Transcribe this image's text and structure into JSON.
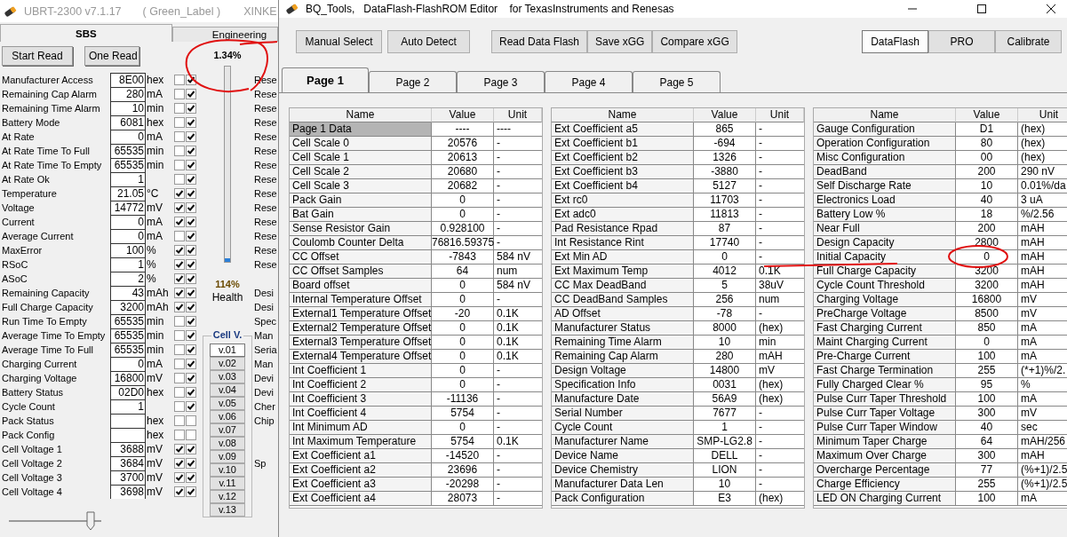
{
  "left_window": {
    "title": "UBRT-2300 v7.1.17",
    "label": "( Green_Label )",
    "vendor": "XINKE",
    "tabs": [
      {
        "label": "SBS",
        "selected": true
      },
      {
        "label": "Engineering",
        "selected": false
      }
    ],
    "buttons": [
      "Start Read",
      "One Read"
    ],
    "progress": {
      "reading": "1.34%",
      "level": 0.0134
    },
    "health": {
      "reading": "114%",
      "label": "Health"
    },
    "rows": [
      {
        "name": "Manufacturer Access",
        "value": "8E00",
        "unit": "hex",
        "check_1": false,
        "check_2": true,
        "side_text": "Rese"
      },
      {
        "name": "Remaining Cap Alarm",
        "value": "280",
        "unit": "mA",
        "check_1": false,
        "check_2": true,
        "side_text": "Rese"
      },
      {
        "name": "Remaining Time Alarm",
        "value": "10",
        "unit": "min",
        "check_1": false,
        "check_2": true,
        "side_text": "Rese"
      },
      {
        "name": "Battery Mode",
        "value": "6081",
        "unit": "hex",
        "check_1": false,
        "check_2": true,
        "side_text": "Rese"
      },
      {
        "name": "At Rate",
        "value": "0",
        "unit": "mA",
        "check_1": false,
        "check_2": true,
        "side_text": "Rese"
      },
      {
        "name": "At Rate Time To Full",
        "value": "65535",
        "unit": "min",
        "check_1": false,
        "check_2": true,
        "side_text": "Rese"
      },
      {
        "name": "At Rate Time To Empty",
        "value": "65535",
        "unit": "min",
        "check_1": false,
        "check_2": true,
        "side_text": "Rese"
      },
      {
        "name": "At Rate Ok",
        "value": "1",
        "check_1": false,
        "check_2": true,
        "side_text": "Rese"
      },
      {
        "name": "Temperature",
        "value": "21.05",
        "unit": "°C",
        "check_1": true,
        "check_2": true,
        "side_text": "Rese"
      },
      {
        "name": "Voltage",
        "value": "14772",
        "unit": "mV",
        "check_1": true,
        "check_2": true,
        "side_text": "Rese"
      },
      {
        "name": "Current",
        "value": "0",
        "unit": "mA",
        "check_1": true,
        "check_2": true,
        "side_text": "Rese"
      },
      {
        "name": "Average Current",
        "value": "0",
        "unit": "mA",
        "check_1": false,
        "check_2": true,
        "side_text": "Rese"
      },
      {
        "name": "MaxError",
        "value": "100",
        "unit": "%",
        "check_1": true,
        "check_2": true,
        "side_text": "Rese"
      },
      {
        "name": "RSoC",
        "value": "1",
        "unit": "%",
        "check_1": true,
        "check_2": true,
        "side_text": "Rese"
      },
      {
        "name": "ASoC",
        "value": "2",
        "unit": "%",
        "check_1": true,
        "check_2": true
      },
      {
        "name": "Remaining Capacity",
        "value": "43",
        "unit": "mAh",
        "check_1": true,
        "check_2": true,
        "side_text": "Desi"
      },
      {
        "name": "Full Charge Capacity",
        "value": "3200",
        "unit": "mAh",
        "check_1": true,
        "check_2": true,
        "side_text": "Desi"
      },
      {
        "name": "Run Time To Empty",
        "value": "65535",
        "unit": "min",
        "check_1": false,
        "check_2": true,
        "side_text": "Spec"
      },
      {
        "name": "Average Time To Empty",
        "value": "65535",
        "unit": "min",
        "check_1": false,
        "check_2": true,
        "side_text": "Man"
      },
      {
        "name": "Average Time To Full",
        "value": "65535",
        "unit": "min",
        "check_1": false,
        "check_2": true,
        "side_text": "Seria"
      },
      {
        "name": "Charging Current",
        "value": "0",
        "unit": "mA",
        "check_1": false,
        "check_2": true,
        "side_text": "Man"
      },
      {
        "name": "Charging Voltage",
        "value": "16800",
        "unit": "mV",
        "check_1": false,
        "check_2": true,
        "side_text": "Devi"
      },
      {
        "name": "Battery Status",
        "value": "02D0",
        "unit": "hex",
        "check_1": false,
        "check_2": true,
        "side_text": "Devi"
      },
      {
        "name": "Cycle Count",
        "value": "1",
        "check_1": false,
        "check_2": true,
        "side_text": "Cher"
      },
      {
        "name": "Pack Status",
        "unit": "hex",
        "check_1": false,
        "check_2": false,
        "side_text": "Chip"
      },
      {
        "name": "Pack Config",
        "unit": "hex",
        "check_1": false,
        "check_2": false
      },
      {
        "name": "Cell Voltage 1",
        "value": "3688",
        "unit": "mV",
        "check_1": true,
        "check_2": true
      },
      {
        "name": "Cell Voltage 2",
        "value": "3684",
        "unit": "mV",
        "check_1": true,
        "check_2": true,
        "side_text": "Sp"
      },
      {
        "name": "Cell Voltage 3",
        "value": "3700",
        "unit": "mV",
        "check_1": true,
        "check_2": true
      },
      {
        "name": "Cell Voltage 4",
        "value": "3698",
        "unit": "mV",
        "check_1": true,
        "check_2": true
      }
    ],
    "cell_voltage_group": {
      "title": "Cell V.",
      "buttons": [
        {
          "label": "v.01",
          "selected": true
        },
        {
          "label": "v.02",
          "selected": false
        },
        {
          "label": "v.03",
          "selected": false
        },
        {
          "label": "v.04",
          "selected": false
        },
        {
          "label": "v.05",
          "selected": false
        },
        {
          "label": "v.06",
          "selected": false
        },
        {
          "label": "v.07",
          "selected": false
        },
        {
          "label": "v.08",
          "selected": false
        },
        {
          "label": "v.09",
          "selected": false
        },
        {
          "label": "v.10",
          "selected": false
        },
        {
          "label": "v.11",
          "selected": false
        },
        {
          "label": "v.12",
          "selected": false
        },
        {
          "label": "v.13",
          "selected": false
        }
      ]
    },
    "slider": {
      "level": 0.88
    }
  },
  "right_window": {
    "title": "BQ_Tools,   DataFlash-FlashROM Editor    for TexasInstruments and Renesas",
    "toolbar_groups": [
      [
        "Manual Select",
        "Auto Detect"
      ],
      [
        "Read Data Flash",
        "Save xGG",
        "Compare xGG"
      ]
    ],
    "modes": [
      {
        "label": "DataFlash",
        "selected": true
      },
      {
        "label": "PRO",
        "selected": false
      },
      {
        "label": "Calibrate",
        "selected": false
      }
    ],
    "tabs": [
      {
        "label": "Page 1",
        "selected": true
      },
      {
        "label": "Page 2",
        "selected": false
      },
      {
        "label": "Page 3",
        "selected": false
      },
      {
        "label": "Page 4",
        "selected": false
      },
      {
        "label": "Page 5",
        "selected": false
      }
    ],
    "tables": [
      {
        "columns": [
          "Name",
          "Value",
          "Unit"
        ],
        "rows": [
          {
            "name": "Page 1 Data",
            "value": "----",
            "unit": "----",
            "selected": true
          },
          {
            "name": "Cell Scale 0",
            "value": "20576",
            "unit": "-",
            "selected": false
          },
          {
            "name": "Cell Scale 1",
            "value": "20613",
            "unit": "-",
            "selected": false
          },
          {
            "name": "Cell Scale 2",
            "value": "20680",
            "unit": "-",
            "selected": false
          },
          {
            "name": "Cell Scale 3",
            "value": "20682",
            "unit": "-",
            "selected": false
          },
          {
            "name": "Pack Gain",
            "value": "0",
            "unit": "-",
            "selected": false
          },
          {
            "name": "Bat Gain",
            "value": "0",
            "unit": "-",
            "selected": false
          },
          {
            "name": "Sense Resistor Gain",
            "value": "0.928100",
            "unit": "-",
            "selected": false
          },
          {
            "name": "Coulomb Counter Delta",
            "value": "76816.59375",
            "unit": "-",
            "selected": false
          },
          {
            "name": "CC Offset",
            "value": "-7843",
            "unit": "584 nV",
            "selected": false
          },
          {
            "name": "CC Offset Samples",
            "value": "64",
            "unit": "num",
            "selected": false
          },
          {
            "name": "Board offset",
            "value": "0",
            "unit": "584 nV",
            "selected": false
          },
          {
            "name": "Internal Temperature Offset",
            "value": "0",
            "unit": "-",
            "selected": false
          },
          {
            "name": "External1 Temperature Offset",
            "value": "-20",
            "unit": "0.1K",
            "selected": false
          },
          {
            "name": "External2 Temperature Offset",
            "value": "0",
            "unit": "0.1K",
            "selected": false
          },
          {
            "name": "External3 Temperature Offset",
            "value": "0",
            "unit": "0.1K",
            "selected": false
          },
          {
            "name": "External4 Temperature Offset",
            "value": "0",
            "unit": "0.1K",
            "selected": false
          },
          {
            "name": "Int Coefficient 1",
            "value": "0",
            "unit": "-",
            "selected": false
          },
          {
            "name": "Int Coefficient 2",
            "value": "0",
            "unit": "-",
            "selected": false
          },
          {
            "name": "Int Coefficient 3",
            "value": "-11136",
            "unit": "-",
            "selected": false
          },
          {
            "name": "Int Coefficient 4",
            "value": "5754",
            "unit": "-",
            "selected": false
          },
          {
            "name": "Int Minimum AD",
            "value": "0",
            "unit": "-",
            "selected": false
          },
          {
            "name": "Int Maximum Temperature",
            "value": "5754",
            "unit": "0.1K",
            "selected": false
          },
          {
            "name": "Ext Coefficient a1",
            "value": "-14520",
            "unit": "-",
            "selected": false
          },
          {
            "name": "Ext Coefficient a2",
            "value": "23696",
            "unit": "-",
            "selected": false
          },
          {
            "name": "Ext Coefficient a3",
            "value": "-20298",
            "unit": "-",
            "selected": false
          },
          {
            "name": "Ext Coefficient a4",
            "value": "28073",
            "unit": "-",
            "selected": false
          }
        ]
      },
      {
        "columns": [
          "Name",
          "Value",
          "Unit"
        ],
        "rows": [
          {
            "name": "Ext Coefficient a5",
            "value": "865",
            "unit": "-",
            "selected": false
          },
          {
            "name": "Ext Coefficient b1",
            "value": "-694",
            "unit": "-",
            "selected": false
          },
          {
            "name": "Ext Coefficient b2",
            "value": "1326",
            "unit": "-",
            "selected": false
          },
          {
            "name": "Ext Coefficient b3",
            "value": "-3880",
            "unit": "-",
            "selected": false
          },
          {
            "name": "Ext Coefficient b4",
            "value": "5127",
            "unit": "-",
            "selected": false
          },
          {
            "name": "Ext rc0",
            "value": "11703",
            "unit": "-",
            "selected": false
          },
          {
            "name": "Ext adc0",
            "value": "11813",
            "unit": "-",
            "selected": false
          },
          {
            "name": "Pad Resistance Rpad",
            "value": "87",
            "unit": "-",
            "selected": false
          },
          {
            "name": "Int Resistance Rint",
            "value": "17740",
            "unit": "-",
            "selected": false
          },
          {
            "name": "Ext Min AD",
            "value": "0",
            "unit": "-",
            "selected": false
          },
          {
            "name": "Ext Maximum Temp",
            "value": "4012",
            "unit": "0.1K",
            "selected": false
          },
          {
            "name": "CC Max DeadBand",
            "value": "5",
            "unit": "38uV",
            "selected": false
          },
          {
            "name": "CC DeadBand Samples",
            "value": "256",
            "unit": "num",
            "selected": false
          },
          {
            "name": "AD Offset",
            "value": "-78",
            "unit": "-",
            "selected": false
          },
          {
            "name": "Manufacturer Status",
            "value": "8000",
            "unit": "(hex)",
            "selected": false
          },
          {
            "name": "Remaining Time Alarm",
            "value": "10",
            "unit": "min",
            "selected": false
          },
          {
            "name": "Remaining Cap Alarm",
            "value": "280",
            "unit": "mAH",
            "selected": false
          },
          {
            "name": "Design Voltage",
            "value": "14800",
            "unit": "mV",
            "selected": false
          },
          {
            "name": "Specification Info",
            "value": "0031",
            "unit": "(hex)",
            "selected": false
          },
          {
            "name": "Manufacture Date",
            "value": "56A9",
            "unit": "(hex)",
            "selected": false
          },
          {
            "name": "Serial Number",
            "value": "7677",
            "unit": "-",
            "selected": false
          },
          {
            "name": "Cycle Count",
            "value": "1",
            "unit": "-",
            "selected": false
          },
          {
            "name": "Manufacturer Name",
            "value": "SMP-LG2.8",
            "unit": "-",
            "selected": false
          },
          {
            "name": "Device Name",
            "value": "DELL",
            "unit": "-",
            "selected": false
          },
          {
            "name": "Device Chemistry",
            "value": "LION",
            "unit": "-",
            "selected": false
          },
          {
            "name": "Manufacturer Data Len",
            "value": "10",
            "unit": "-",
            "selected": false
          },
          {
            "name": "Pack Configuration",
            "value": "E3",
            "unit": "(hex)",
            "selected": false
          }
        ]
      },
      {
        "columns": [
          "Name",
          "Value",
          "Unit"
        ],
        "rows": [
          {
            "name": "Gauge Configuration",
            "value": "D1",
            "unit": "(hex)",
            "selected": false
          },
          {
            "name": "Operation Configuration",
            "value": "80",
            "unit": "(hex)",
            "selected": false
          },
          {
            "name": "Misc Configuration",
            "value": "00",
            "unit": "(hex)",
            "selected": false
          },
          {
            "name": "DeadBand",
            "value": "200",
            "unit": "290 nV",
            "selected": false
          },
          {
            "name": "Self Discharge Rate",
            "value": "10",
            "unit": "0.01%/da",
            "selected": false
          },
          {
            "name": "Electronics Load",
            "value": "40",
            "unit": "3 uA",
            "selected": false
          },
          {
            "name": "Battery Low %",
            "value": "18",
            "unit": "%/2.56",
            "selected": false
          },
          {
            "name": "Near Full",
            "value": "200",
            "unit": "mAH",
            "selected": false
          },
          {
            "name": "Design Capacity",
            "value": "2800",
            "unit": "mAH",
            "selected": false
          },
          {
            "name": "Initial Capacity",
            "value": "0",
            "unit": "mAH",
            "selected": false
          },
          {
            "name": "Full Charge Capacity",
            "value": "3200",
            "unit": "mAH",
            "selected": false
          },
          {
            "name": "Cycle Count Threshold",
            "value": "3200",
            "unit": "mAH",
            "selected": false
          },
          {
            "name": "Charging Voltage",
            "value": "16800",
            "unit": "mV",
            "selected": false
          },
          {
            "name": "PreCharge Voltage",
            "value": "8500",
            "unit": "mV",
            "selected": false
          },
          {
            "name": "Fast Charging Current",
            "value": "850",
            "unit": "mA",
            "selected": false
          },
          {
            "name": "Maint Charging Current",
            "value": "0",
            "unit": "mA",
            "selected": false
          },
          {
            "name": "Pre-Charge Current",
            "value": "100",
            "unit": "mA",
            "selected": false
          },
          {
            "name": "Fast Charge Termination",
            "value": "255",
            "unit": "(*+1)%/2.",
            "selected": false
          },
          {
            "name": "Fully Charged Clear %",
            "value": "95",
            "unit": "%",
            "selected": false
          },
          {
            "name": "Pulse Curr Taper Threshold",
            "value": "100",
            "unit": "mA",
            "selected": false
          },
          {
            "name": "Pulse Curr Taper Voltage",
            "value": "300",
            "unit": "mV",
            "selected": false
          },
          {
            "name": "Pulse Curr Taper Window",
            "value": "40",
            "unit": "sec",
            "selected": false
          },
          {
            "name": "Minimum Taper Charge",
            "value": "64",
            "unit": "mAH/256",
            "selected": false
          },
          {
            "name": "Maximum Over Charge",
            "value": "300",
            "unit": "mAH",
            "selected": false
          },
          {
            "name": "Overcharge Percentage",
            "value": "77",
            "unit": "(%+1)/2.5",
            "selected": false
          },
          {
            "name": "Charge Efficiency",
            "value": "255",
            "unit": "(%+1)/2.5",
            "selected": false
          },
          {
            "name": "LED ON Charging Current",
            "value": "100",
            "unit": "mA",
            "selected": false
          }
        ]
      }
    ]
  }
}
